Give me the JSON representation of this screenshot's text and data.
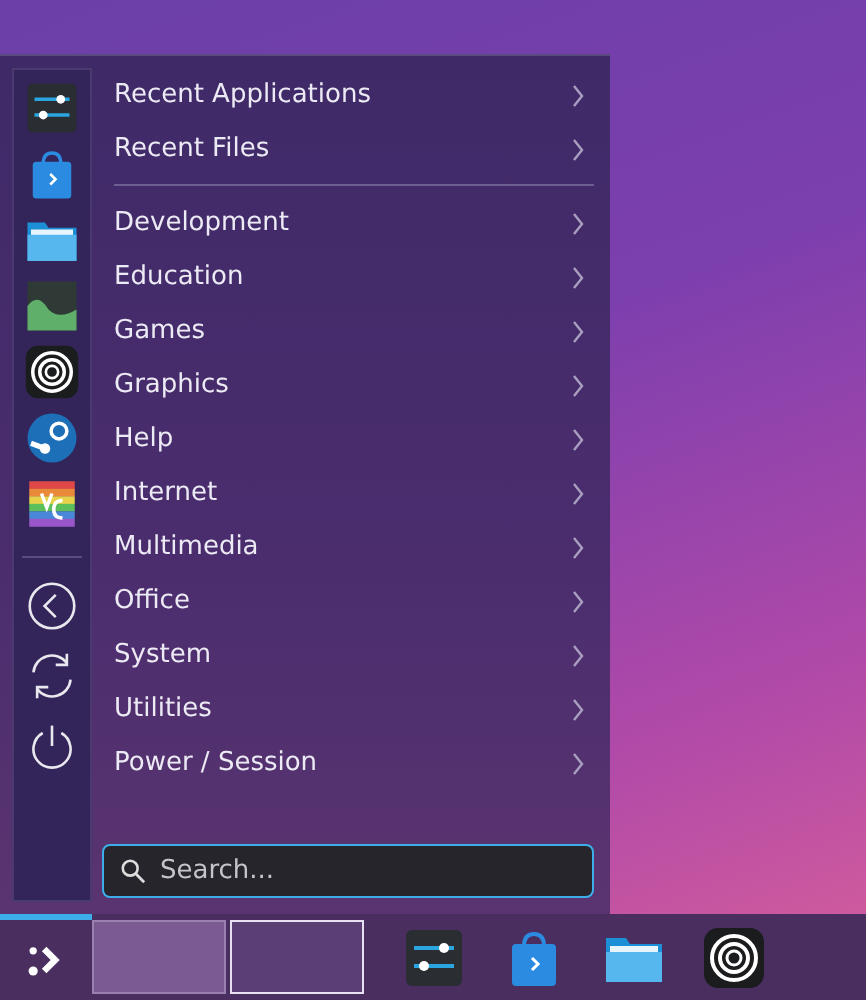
{
  "menu": {
    "recent": [
      {
        "label": "Recent Applications"
      },
      {
        "label": "Recent Files"
      }
    ],
    "categories": [
      {
        "label": "Development"
      },
      {
        "label": "Education"
      },
      {
        "label": "Games"
      },
      {
        "label": "Graphics"
      },
      {
        "label": "Help"
      },
      {
        "label": "Internet"
      },
      {
        "label": "Multimedia"
      },
      {
        "label": "Office"
      },
      {
        "label": "System"
      },
      {
        "label": "Utilities"
      },
      {
        "label": "Power / Session"
      }
    ],
    "favorites": [
      {
        "kind": "sliders"
      },
      {
        "kind": "bag"
      },
      {
        "kind": "folder"
      },
      {
        "kind": "landscape"
      },
      {
        "kind": "rings"
      },
      {
        "kind": "steam"
      },
      {
        "kind": "rainbow"
      }
    ],
    "actions": [
      {
        "kind": "back"
      },
      {
        "kind": "refresh"
      },
      {
        "kind": "power"
      }
    ],
    "search": {
      "placeholder": "Search..."
    }
  },
  "taskbar": {
    "launcher_active": true,
    "desktops": [
      {
        "selected": true
      },
      {
        "selected": false
      }
    ],
    "tasks": [
      {
        "kind": "sliders"
      },
      {
        "kind": "bag"
      },
      {
        "kind": "folder"
      },
      {
        "kind": "rings"
      }
    ]
  }
}
